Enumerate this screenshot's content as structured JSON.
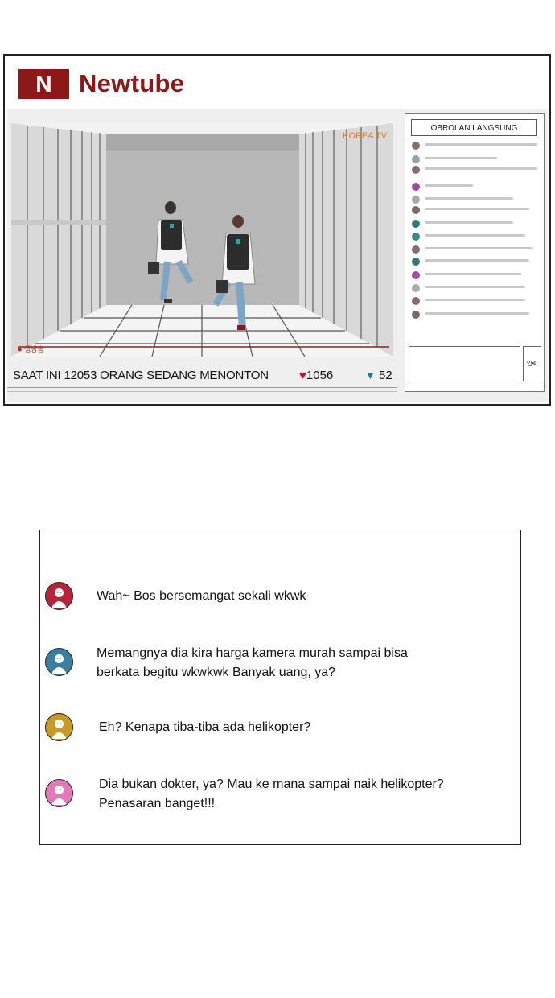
{
  "app": {
    "logo_letter": "N",
    "brand_name": "Newtube"
  },
  "video": {
    "overlay_label": "KOREA TV",
    "live_label": "● 생방송"
  },
  "info_bar": {
    "watching_text": "SAAT INI  12053 ORANG SEDANG MENONTON",
    "likes": "1056",
    "dislikes": "52",
    "heart_icon": "♥",
    "down_icon": "▼"
  },
  "chat": {
    "title": "OBROLAN LANGSUNG",
    "send_label": "입력",
    "input_value": ""
  },
  "comments": [
    {
      "avatar_color": "#b5243a",
      "text": "Wah~ Bos bersemangat sekali wkwk"
    },
    {
      "avatar_color": "#3c7ea0",
      "text": "Memangnya dia kira harga kamera murah sampai bisa\nberkata begitu wkwkwk Banyak uang, ya?"
    },
    {
      "avatar_color": "#c89a2a",
      "text": "Eh? Kenapa tiba-tiba ada helikopter?"
    },
    {
      "avatar_color": "#e07ab8",
      "text": "Dia bukan dokter, ya? Mau ke mana sampai naik helikopter?\nPenasaran banget!!!"
    }
  ],
  "colors": {
    "brand": "#8c1818",
    "heart": "#c8112e",
    "dislike": "#1d7a92",
    "korea_tv": "#ee7a1a"
  }
}
